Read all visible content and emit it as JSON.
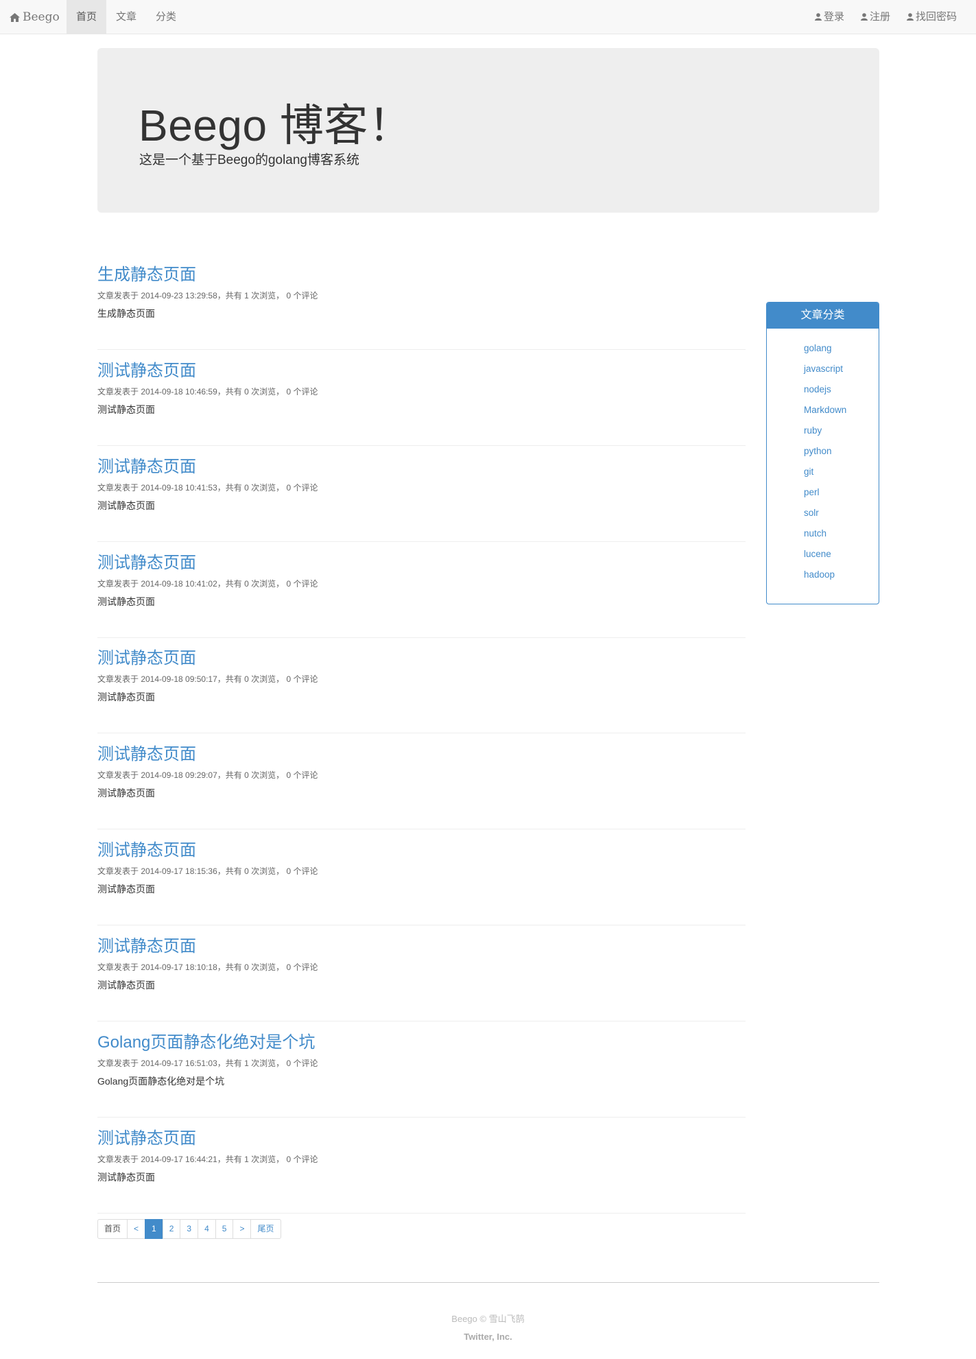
{
  "navbar": {
    "brand": "Beego",
    "left_items": [
      {
        "label": "首页",
        "active": true
      },
      {
        "label": "文章",
        "active": false
      },
      {
        "label": "分类",
        "active": false
      }
    ],
    "right_items": [
      {
        "label": "登录"
      },
      {
        "label": "注册"
      },
      {
        "label": "找回密码"
      }
    ]
  },
  "jumbotron": {
    "title": "Beego 博客！",
    "subtitle": "这是一个基于Beego的golang博客系统"
  },
  "posts": [
    {
      "title": "生成静态页面",
      "meta": "文章发表于 2014-09-23 13:29:58，共有 1 次浏览， 0 个评论",
      "summary": "生成静态页面"
    },
    {
      "title": "测试静态页面",
      "meta": "文章发表于 2014-09-18 10:46:59，共有 0 次浏览， 0 个评论",
      "summary": "测试静态页面"
    },
    {
      "title": "测试静态页面",
      "meta": "文章发表于 2014-09-18 10:41:53，共有 0 次浏览， 0 个评论",
      "summary": "测试静态页面"
    },
    {
      "title": "测试静态页面",
      "meta": "文章发表于 2014-09-18 10:41:02，共有 0 次浏览， 0 个评论",
      "summary": "测试静态页面"
    },
    {
      "title": "测试静态页面",
      "meta": "文章发表于 2014-09-18 09:50:17，共有 0 次浏览， 0 个评论",
      "summary": "测试静态页面"
    },
    {
      "title": "测试静态页面",
      "meta": "文章发表于 2014-09-18 09:29:07，共有 0 次浏览， 0 个评论",
      "summary": "测试静态页面"
    },
    {
      "title": "测试静态页面",
      "meta": "文章发表于 2014-09-17 18:15:36，共有 0 次浏览， 0 个评论",
      "summary": "测试静态页面"
    },
    {
      "title": "测试静态页面",
      "meta": "文章发表于 2014-09-17 18:10:18，共有 0 次浏览， 0 个评论",
      "summary": "测试静态页面"
    },
    {
      "title": "Golang页面静态化绝对是个坑",
      "meta": "文章发表于 2014-09-17 16:51:03，共有 1 次浏览， 0 个评论",
      "summary": "Golang页面静态化绝对是个坑"
    },
    {
      "title": "测试静态页面",
      "meta": "文章发表于 2014-09-17 16:44:21，共有 1 次浏览， 0 个评论",
      "summary": "测试静态页面"
    }
  ],
  "sidebar": {
    "title": "文章分类",
    "categories": [
      "golang",
      "javascript",
      "nodejs",
      "Markdown",
      "ruby",
      "python",
      "git",
      "perl",
      "solr",
      "nutch",
      "lucene",
      "hadoop"
    ]
  },
  "pagination": {
    "first": "首页",
    "prev": "<",
    "pages": [
      "1",
      "2",
      "3",
      "4",
      "5"
    ],
    "current": "1",
    "next": ">",
    "last": "尾页"
  },
  "footer": {
    "copyright": "Beego © 雪山飞鹄",
    "company": "Twitter, Inc."
  },
  "colors": {
    "accent": "#428bca",
    "jumbotron_bg": "#eeeeee",
    "navbar_bg": "#f8f8f8"
  }
}
